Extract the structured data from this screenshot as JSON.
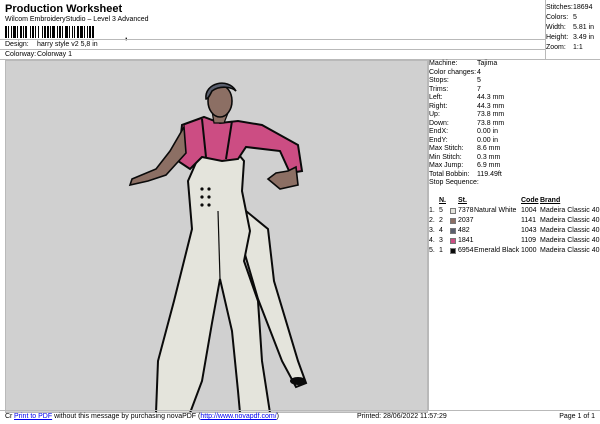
{
  "header": {
    "title": "Production Worksheet",
    "software": "Wilcom EmbroideryStudio – Level 3 Advanced",
    "barcode_mark": ",",
    "design_label": "Design:",
    "design_value": "harry style v2 5,8 in",
    "colorway_label": "Colorway:",
    "colorway_value": "Colorway 1"
  },
  "topstats": [
    {
      "label": "Stitches:",
      "value": "18694"
    },
    {
      "label": "Colors:",
      "value": "5"
    },
    {
      "label": "Width:",
      "value": "5.81 in"
    },
    {
      "label": "Height:",
      "value": "3.49 in"
    },
    {
      "label": "Zoom:",
      "value": "1:1"
    }
  ],
  "details": [
    {
      "label": "Machine:",
      "value": "Tajima"
    },
    {
      "label": "Color changes:",
      "value": "4"
    },
    {
      "label": "Stops:",
      "value": "5"
    },
    {
      "label": "Trims:",
      "value": "7"
    },
    {
      "label": "Left:",
      "value": "44.3 mm"
    },
    {
      "label": "Right:",
      "value": "44.3 mm"
    },
    {
      "label": "Up:",
      "value": "73.8 mm"
    },
    {
      "label": "Down:",
      "value": "73.8 mm"
    },
    {
      "label": "EndX:",
      "value": "0.00 in"
    },
    {
      "label": "EndY:",
      "value": "0.00 in"
    },
    {
      "label": "Max Stitch:",
      "value": "8.6 mm"
    },
    {
      "label": "Min Stitch:",
      "value": "0.3 mm"
    },
    {
      "label": "Max Jump:",
      "value": "6.9 mm"
    },
    {
      "label": "Total Bobbin:",
      "value": "119.49ft"
    }
  ],
  "stop_sequence": {
    "title": "Stop Sequence:",
    "headers": {
      "n": "N.",
      "st": "St.",
      "code": "Code",
      "brand": "Brand"
    },
    "rows": [
      {
        "idx": "1.",
        "n": "5",
        "swatch": "#e4e4dc",
        "st": "7378",
        "name": "Natural White",
        "code": "1004",
        "brand": "Madeira Classic 40"
      },
      {
        "idx": "2.",
        "n": "2",
        "swatch": "#8c6f64",
        "st": "2037",
        "name": "",
        "code": "1141",
        "brand": "Madeira Classic 40"
      },
      {
        "idx": "3.",
        "n": "4",
        "swatch": "#5a5f6e",
        "st": "482",
        "name": "",
        "code": "1043",
        "brand": "Madeira Classic 40"
      },
      {
        "idx": "4.",
        "n": "3",
        "swatch": "#cc4d83",
        "st": "1841",
        "name": "",
        "code": "1109",
        "brand": "Madeira Classic 40"
      },
      {
        "idx": "5.",
        "n": "1",
        "swatch": "#0a0a0a",
        "st": "6954",
        "name": "Emerald Black",
        "code": "1000",
        "brand": "Madeira Classic 40"
      }
    ]
  },
  "footer": {
    "prefix": "Cr",
    "link": "Print to PDF",
    "middle": " without this message by purchasing novaPDF (",
    "url": "http://www.novapdf.com/",
    "suffix": ")",
    "printed": "Printed: 28/06/2022 11:57:29",
    "page": "Page 1 of 1"
  },
  "colors": {
    "canvas_bg": "#d0d0d0",
    "skin": "#8c6f64",
    "shirt": "#cc4d83",
    "pants": "#e4e4dc",
    "outline": "#0a0a0a",
    "hair": "#5a5f6e"
  }
}
